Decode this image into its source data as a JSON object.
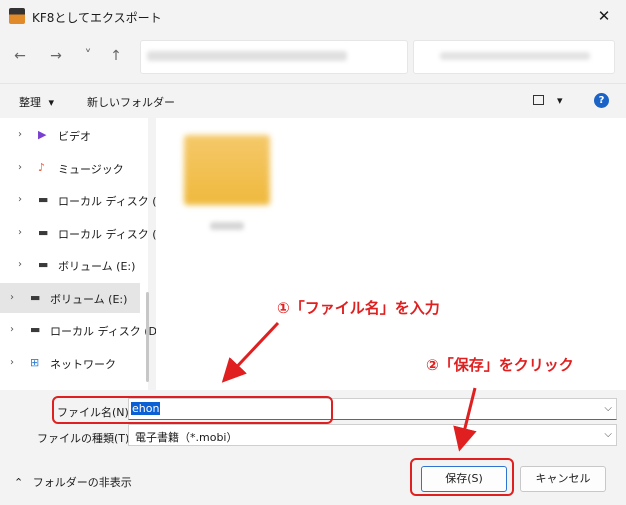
{
  "window": {
    "title": "KF8としてエクスポート",
    "close_glyph": "✕"
  },
  "nav": {
    "back": "←",
    "forward": "→",
    "recent": "˅",
    "up": "↑"
  },
  "toolbar": {
    "organize": "整理",
    "organize_arrow": "▾",
    "new_folder": "新しいフォルダー",
    "view_arrow": "▾",
    "help": "?"
  },
  "sidebar": {
    "items": [
      {
        "label": "ビデオ",
        "icon": "video-icon",
        "color": "#7a3fd1"
      },
      {
        "label": "ミュージック",
        "icon": "music-icon",
        "color": "#e65a3a"
      },
      {
        "label": "ローカル ディスク (",
        "icon": "drive-icon",
        "color": "#3a3a3a"
      },
      {
        "label": "ローカル ディスク (",
        "icon": "drive-icon",
        "color": "#3a3a3a"
      },
      {
        "label": "ボリューム (E:)",
        "icon": "drive-icon",
        "color": "#3a3a3a"
      },
      {
        "label": "ボリューム (E:)",
        "icon": "drive-icon",
        "color": "#3a3a3a",
        "selected": true
      },
      {
        "label": "ローカル ディスク (D",
        "icon": "drive-icon",
        "color": "#3a3a3a"
      },
      {
        "label": "ネットワーク",
        "icon": "network-icon",
        "color": "#2f7fd1"
      }
    ]
  },
  "form": {
    "filename_label": "ファイル名(N):",
    "filename_value": "ehon",
    "filetype_label": "ファイルの種類(T):",
    "filetype_value": "電子書籍（*.mobi）"
  },
  "footer": {
    "hide_folders": "フォルダーの非表示",
    "hide_arrow": "⌃",
    "save": "保存(S)",
    "cancel": "キャンセル"
  },
  "annotations": {
    "step1": "①「ファイル名」を入力",
    "step2": "②「保存」をクリック",
    "color": "#e02020"
  }
}
